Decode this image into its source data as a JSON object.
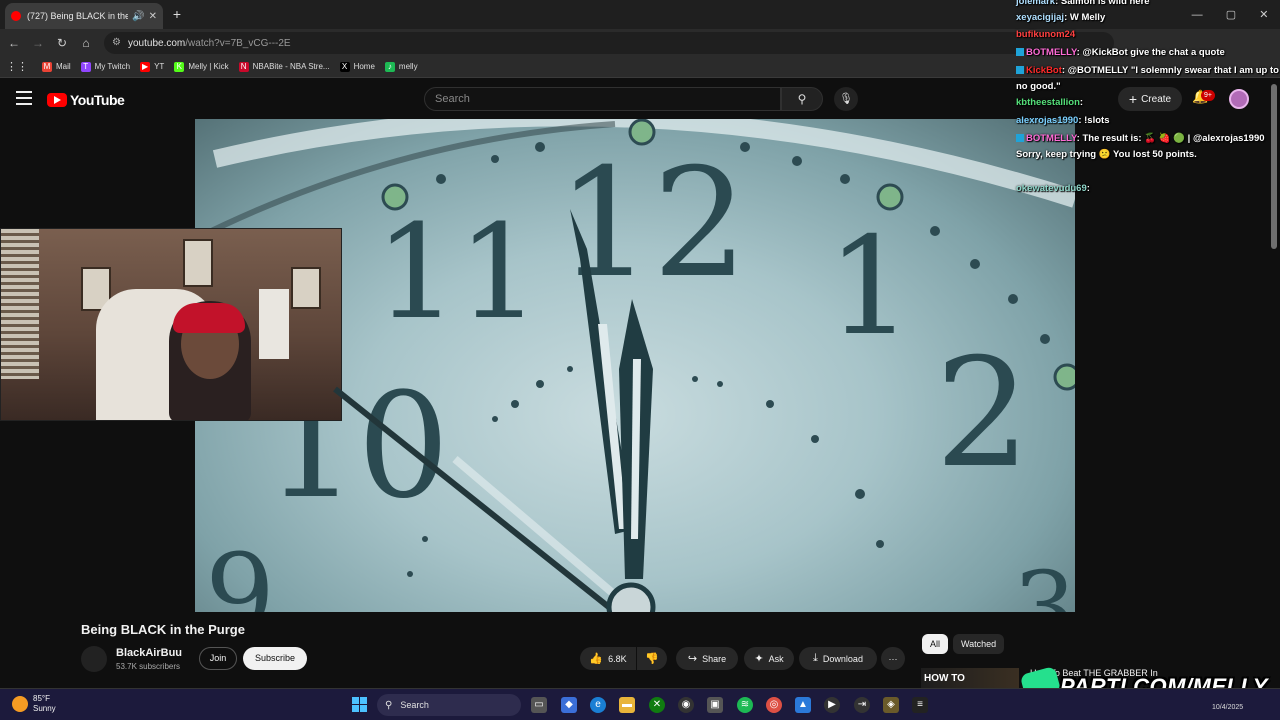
{
  "browser": {
    "tab_title": "(727) Being BLACK in the Purge",
    "new_tab_icon": "+",
    "url_host": "youtube.com",
    "url_path": "/watch?v=7B_vCG---2E",
    "bookmarks": [
      {
        "label": "Mail",
        "icon": "M",
        "color": "#ea4335"
      },
      {
        "label": "My Twitch",
        "icon": "T",
        "color": "#9146ff"
      },
      {
        "label": "YT",
        "icon": "▶",
        "color": "#ff0000"
      },
      {
        "label": "Melly | Kick",
        "icon": "K",
        "color": "#53fc18"
      },
      {
        "label": "NBABite - NBA Stre...",
        "icon": "N",
        "color": "#c9082a"
      },
      {
        "label": "Home",
        "icon": "X",
        "color": "#000000"
      },
      {
        "label": "melly",
        "icon": "♪",
        "color": "#1db954"
      }
    ]
  },
  "youtube": {
    "logo_text": "YouTube",
    "search_placeholder": "Search",
    "create_label": "Create",
    "notif_count": "9+",
    "video_title": "Being BLACK in the Purge",
    "channel_name": "BlackAirBuu",
    "subscribers": "53.7K subscribers",
    "join_label": "Join",
    "subscribe_label": "Subscribe",
    "likes": "6.8K",
    "share_label": "Share",
    "ask_label": "Ask",
    "download_label": "Download",
    "more_label": "···",
    "chips": [
      "All",
      "Watched"
    ],
    "suggestion_thumb_text": "HOW TO",
    "suggestion_title": "How To Beat THE GRABBER In"
  },
  "clock_face": {
    "numerals": [
      "12",
      "11",
      "1",
      "2",
      "10",
      "9",
      "3"
    ]
  },
  "chat": [
    {
      "user": "jolemark",
      "color": "#b0e0ff",
      "text": ": Salmon is wild here",
      "badge": false
    },
    {
      "user": "xeyacigijaj",
      "color": "#b0e0ff",
      "text": ": W Melly",
      "badge": false
    },
    {
      "user": "bufikunom24",
      "color": "#ff4040",
      "text": "",
      "badge": false
    },
    {
      "user": "BOTMELLY",
      "color": "#ff6bd6",
      "text": ": @KickBot give the chat a quote",
      "badge": true
    },
    {
      "user": "KickBot",
      "color": "#ff2a2a",
      "text": ": @BOTMELLY \"I solemnly swear that I am up to no good.\"",
      "badge": true
    },
    {
      "user": "kbtheestallion",
      "color": "#55e07a",
      "text": ": ",
      "badge": false
    },
    {
      "user": "alexrojas1990",
      "color": "#7ad0ff",
      "text": ": !slots",
      "badge": false
    },
    {
      "user": "BOTMELLY",
      "color": "#ff6bd6",
      "text": ": The result is: 🍒 🍓 🟢 | @alexrojas1990 Sorry, keep trying 😕 You lost 50 points.",
      "badge": true
    },
    {
      "user": "okewatevudu69",
      "color": "#8fd6c9",
      "text": ": ",
      "badge": false
    }
  ],
  "taskbar": {
    "temperature": "85°F",
    "condition": "Sunny",
    "search_label": "Search",
    "date": "10/4/2025"
  },
  "overlay": {
    "brand": "PARTI.COM/MELLY"
  }
}
